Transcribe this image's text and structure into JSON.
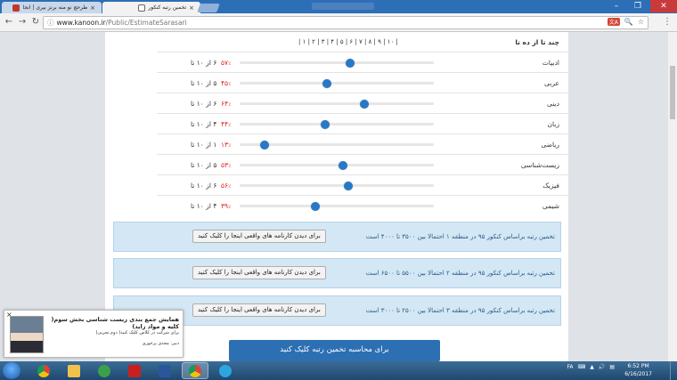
{
  "browser": {
    "tabs": [
      {
        "title": "تخمین رتبه کنکور",
        "active": true
      },
      {
        "title": "طرحچ نو منه برنز بیری | انجا",
        "active": false
      }
    ],
    "url_host": "www.kanoon.ir",
    "url_path": "/Public/EstimateSarasari",
    "translate_badge": "文A"
  },
  "scale": {
    "label": "چند تا از ده تا",
    "ticks": "| ۱ | ۲ | ۳ | ۴ | ۵ | ۶ | ۷ | ۸ | ۹ | ۱۰ |"
  },
  "subjects": [
    {
      "name": "ادبیات",
      "percent": "۵۷",
      "range": "۶ از ۱۰ تا",
      "level": 0.57
    },
    {
      "name": "عربی",
      "percent": "۴۵",
      "range": "۵ از ۱۰ تا",
      "level": 0.45
    },
    {
      "name": "دینی",
      "percent": "۶۴",
      "range": "۶ از ۱۰ تا",
      "level": 0.64
    },
    {
      "name": "زبان",
      "percent": "۴۴",
      "range": "۴ از ۱۰ تا",
      "level": 0.44
    },
    {
      "name": "ریاضی",
      "percent": "۱۳",
      "range": "۱ از ۱۰ تا",
      "level": 0.13
    },
    {
      "name": "زیست‌شناسی",
      "percent": "۵۳",
      "range": "۵ از ۱۰ تا",
      "level": 0.53
    },
    {
      "name": "فیزیک",
      "percent": "۵۶",
      "range": "۶ از ۱۰ تا",
      "level": 0.56
    },
    {
      "name": "شیمی",
      "percent": "۳۹",
      "range": "۴ از ۱۰ تا",
      "level": 0.39
    }
  ],
  "percent_sign": "٪",
  "results": [
    {
      "text": "تخمین رتبه براساس کنکور ۹۵ در منطقه ۱ احتمالا بین ۳۵۰۰ تا ۴۰۰۰ است",
      "button": "برای دیدن کارنامه های واقعی اینجا را کلیک کنید"
    },
    {
      "text": "تخمین رتبه براساس کنکور ۹۵ در منطقه ۲ احتمالا بین ۵۵۰۰ تا ۶۵۰۰ است",
      "button": "برای دیدن کارنامه های واقعی اینجا را کلیک کنید"
    },
    {
      "text": "تخمین رتبه براساس کنکور ۹۵ در منطقه ۳ احتمالا بین ۲۵۰۰ تا ۳۰۰۰ است",
      "button": "برای دیدن کارنامه های واقعی اینجا را کلیک کنید"
    }
  ],
  "calc_button": "برای محاسبه تخمین رتبه کلیک کنید",
  "ad": {
    "title": "همایش جمع بندی زیست شناسی بخش سوم( کلیه و مواد زاید)",
    "subtitle": "برای شرکت در کلاس کلیک کنید( دوم تجربی)",
    "author": "دبیر: مجدی پرخوری",
    "close": "×"
  },
  "taskbar": {
    "lang": "FA",
    "time": "6:52 PM",
    "date": "6/16/2017"
  }
}
